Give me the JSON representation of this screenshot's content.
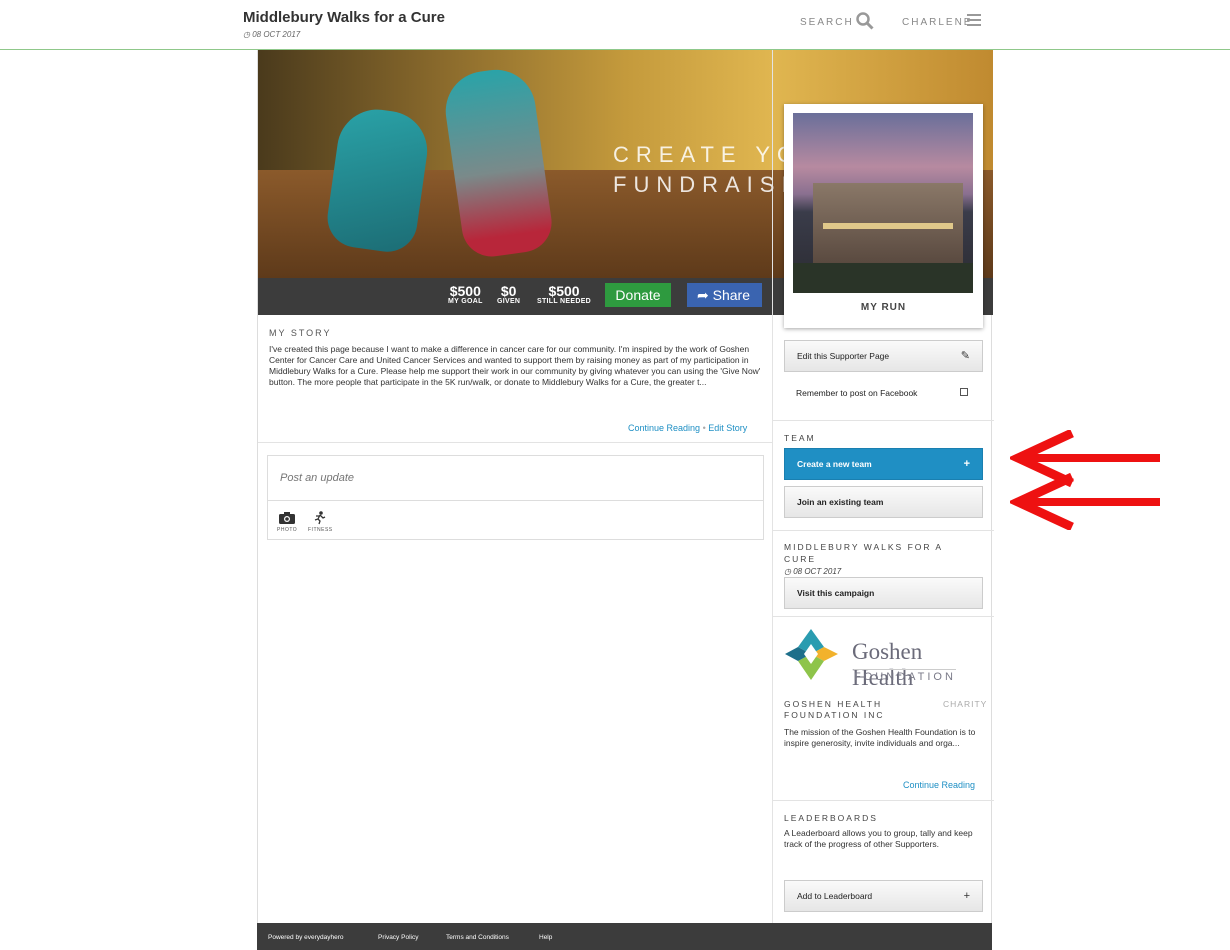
{
  "header": {
    "title": "Middlebury Walks for a Cure",
    "date": "08 OCT 2017",
    "search_label": "SEARCH",
    "user_label": "CHARLENE"
  },
  "hero": {
    "text_line1": "CREATE YO",
    "text_line2": "FUNDRAISI"
  },
  "stats": {
    "goal_value": "$500",
    "goal_label": "MY GOAL",
    "given_value": "$0",
    "given_label": "GIVEN",
    "needed_value": "$500",
    "needed_label": "STILL NEEDED",
    "donate_label": "Donate",
    "share_label": "Share"
  },
  "story": {
    "heading": "MY STORY",
    "text": "I've created this page because I want to make a difference in cancer care for our community. I'm inspired by the work of Goshen Center for Cancer Care and United Cancer Services and wanted to support them by raising money as part of my participation in Middlebury Walks for a Cure. Please help me support their work in our community by giving whatever you can using the 'Give Now' button. The more people that participate in the 5K run/walk, or donate to Middlebury Walks for a Cure, the greater t...",
    "continue_label": "Continue Reading",
    "separator": "•",
    "edit_label": "Edit Story"
  },
  "update": {
    "placeholder": "Post an update",
    "photo_label": "PHOTO",
    "fitness_label": "FITNESS"
  },
  "sidebar": {
    "photo_caption": "MY RUN",
    "edit_page_label": "Edit this Supporter Page",
    "facebook_label": "Remember to post on Facebook",
    "team_heading": "TEAM",
    "create_team_label": "Create a new team",
    "join_team_label": "Join an existing team",
    "campaign_heading": "MIDDLEBURY WALKS FOR A CURE",
    "campaign_date": "08 OCT 2017",
    "visit_campaign_label": "Visit this campaign",
    "logo_name": "Goshen Health",
    "logo_sub": "FOUNDATION",
    "charity_name": "GOSHEN HEALTH FOUNDATION INC",
    "charity_tag": "CHARITY",
    "charity_text": "The mission of the Goshen Health Foundation is to inspire generosity, invite individuals and orga...",
    "charity_continue": "Continue Reading",
    "leaderboards_heading": "LEADERBOARDS",
    "leaderboards_text": "A Leaderboard allows you to group, tally and keep track of the progress of other Supporters.",
    "add_leaderboard_label": "Add to Leaderboard"
  },
  "footer": {
    "powered": "Powered by everydayhero",
    "privacy": "Privacy Policy",
    "terms": "Terms and Conditions",
    "help": "Help"
  },
  "colors": {
    "accent_blue": "#1f8fc4",
    "donate_green": "#2e9a3f",
    "share_blue": "#3a64b0",
    "annotation_red": "#ee1111"
  }
}
